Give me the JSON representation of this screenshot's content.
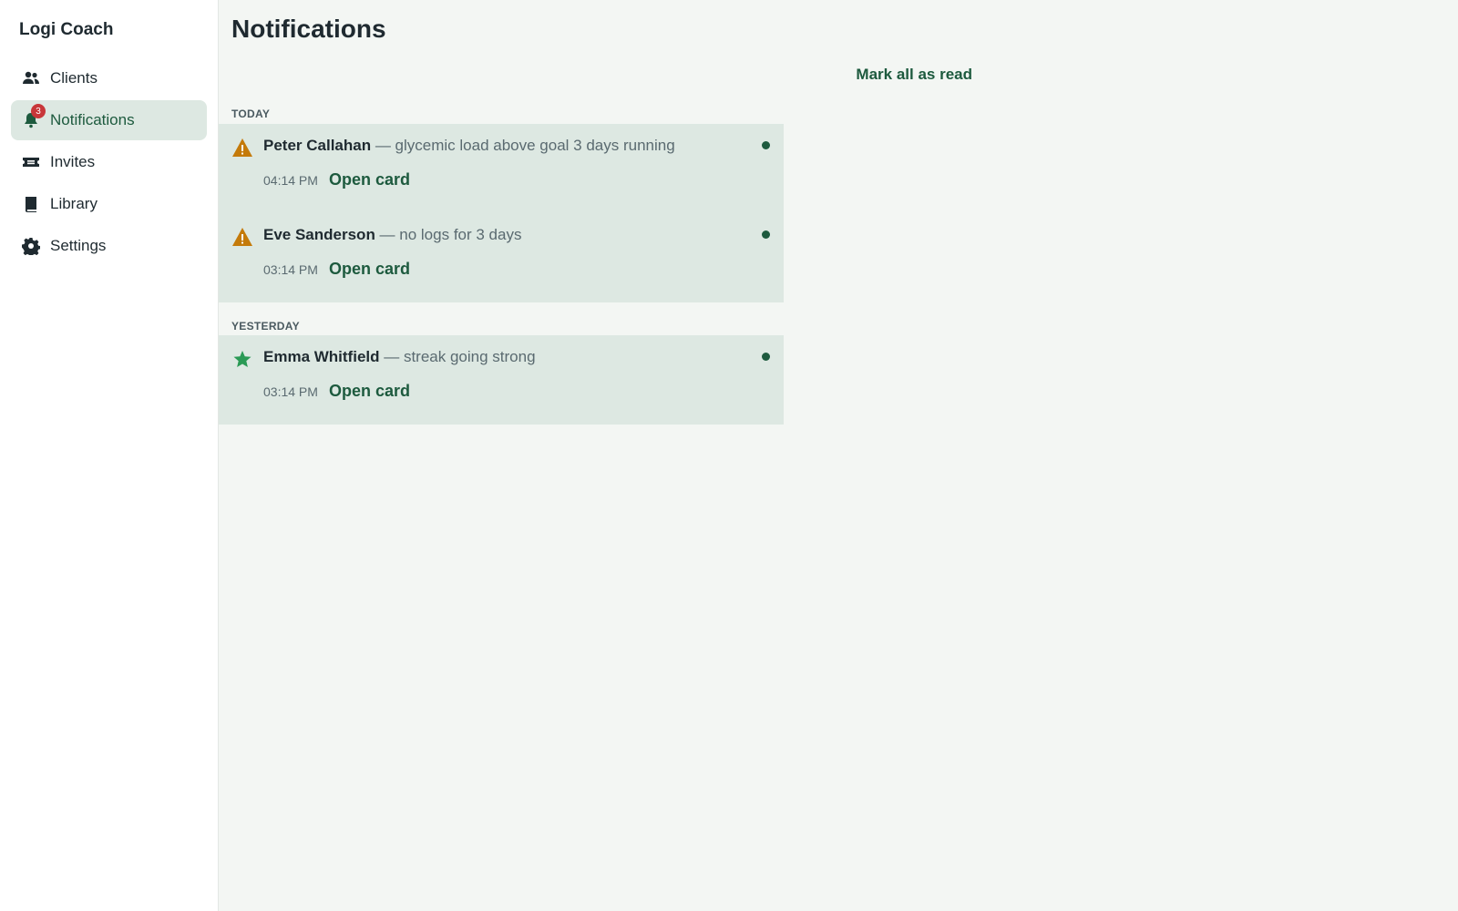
{
  "brand": "Logi Coach",
  "nav": [
    {
      "label": "Clients",
      "icon": "users-icon",
      "active": false
    },
    {
      "label": "Notifications",
      "icon": "bell-icon",
      "active": true,
      "badge": "3"
    },
    {
      "label": "Invites",
      "icon": "ticket-icon",
      "active": false
    },
    {
      "label": "Library",
      "icon": "book-icon",
      "active": false
    },
    {
      "label": "Settings",
      "icon": "gear-icon",
      "active": false
    }
  ],
  "page_title": "Notifications",
  "mark_all_label": "Mark all as read",
  "sections": [
    {
      "label": "TODAY",
      "items": [
        {
          "icon": "warning-icon",
          "name": "Peter Callahan",
          "message": " — glycemic load above goal 3 days running",
          "time": "04:14 PM",
          "action": "Open card",
          "unread": true
        },
        {
          "icon": "warning-icon",
          "name": "Eve Sanderson",
          "message": " — no logs for 3 days",
          "time": "03:14 PM",
          "action": "Open card",
          "unread": true
        }
      ]
    },
    {
      "label": "YESTERDAY",
      "items": [
        {
          "icon": "star-icon",
          "name": "Emma Whitfield",
          "message": " — streak going strong",
          "time": "03:14 PM",
          "action": "Open card",
          "unread": true
        }
      ]
    }
  ],
  "colors": {
    "accent": "#1d5a3e",
    "warning": "#c47a0a",
    "success": "#2a9a55",
    "badge": "#c8373a"
  }
}
